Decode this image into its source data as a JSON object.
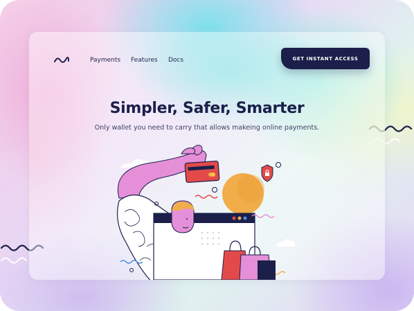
{
  "header": {
    "logo_icon": "wave-logo-icon",
    "nav": [
      "Payments",
      "Features",
      "Docs"
    ],
    "cta_label": "GET INSTANT ACCESS"
  },
  "hero": {
    "title": "Simpler, Safer, Smarter",
    "subtitle": "Only wallet you need to carry that allows makeing online payments."
  },
  "illustration": {
    "name": "person-holding-credit-card-illustration",
    "icons": [
      "credit-card-icon",
      "shield-lock-icon",
      "shopping-bags-icon",
      "browser-window-icon",
      "sun-circle-icon",
      "cloud-icon"
    ]
  },
  "colors": {
    "navy": "#1b1f4a",
    "pink": "#e58fd8",
    "orange": "#f1ad4a",
    "red": "#e24a4a",
    "accent_blue": "#4a90e2"
  }
}
